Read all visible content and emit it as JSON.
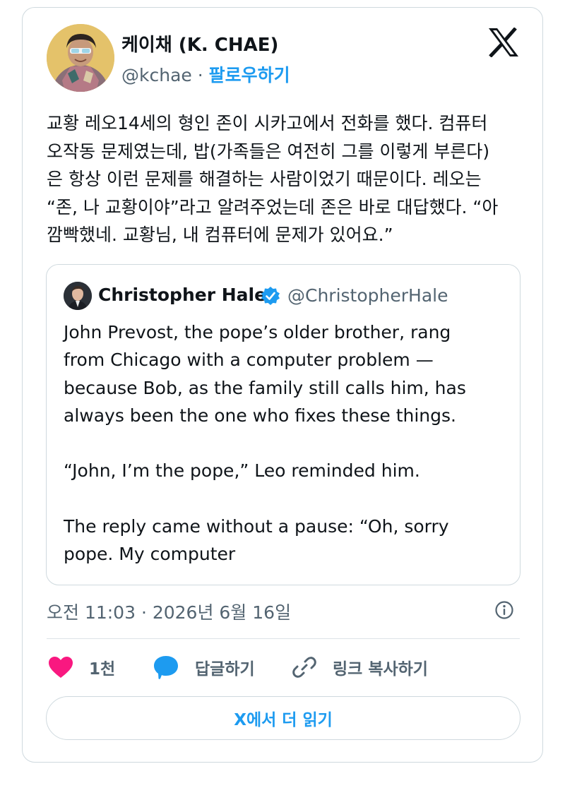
{
  "author": {
    "name": "케이채 (K. CHAE)",
    "handle": "@kchae",
    "separator": "·",
    "follow_label": "팔로우하기"
  },
  "header": {
    "logo_icon": "x-logo-icon"
  },
  "tweet": {
    "lines": [
      "교황 레오14세의 형인 존이 시카고에서 전화를 했다. 컴퓨터",
      "오작동 문제였는데, 밥(가족들은 여전히 그를 이렇게 부른다)",
      "은 항상 이런 문제를 해결하는 사람이었기 때문이다. 레오는",
      "“존, 나 교황이야”라고 알려주었는데 존은 바로 대답했다. “아",
      "깜빡했네. 교황님, 내 컴퓨터에 문제가 있어요.”"
    ]
  },
  "quote": {
    "name": "Christopher Hale",
    "handle": "@ChristopherHale",
    "verified": true,
    "lines": [
      "John Prevost, the pope’s older brother, rang",
      "from Chicago with a computer problem —",
      "because Bob, as the family still calls him, has",
      "always been the one who fixes these things.",
      "",
      "“John, I’m the pope,” Leo reminded him.",
      "",
      "The reply came without a pause: “Oh, sorry",
      "pope. My computer"
    ]
  },
  "meta": {
    "timestamp": "오전 11:03 · 2026년 6월 16일",
    "info_icon": "info-icon"
  },
  "actions": {
    "like_count": "1천",
    "reply_label": "답글하기",
    "copy_link_label": "링크 복사하기"
  },
  "read_more_label": "X에서 더 읽기",
  "colors": {
    "accent": "#1d9bf0",
    "like": "#f91880",
    "secondary_text": "#536471",
    "border": "#cfd9de"
  }
}
